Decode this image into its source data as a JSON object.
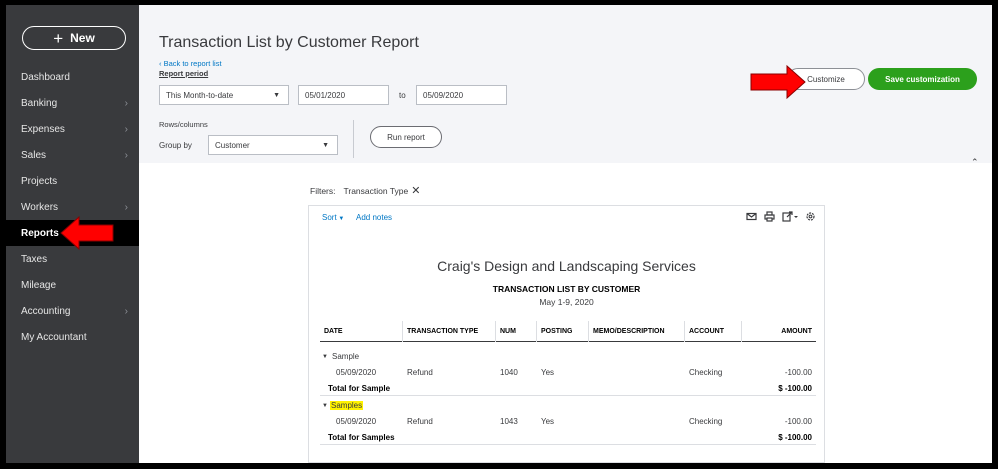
{
  "sidebar": {
    "new_label": "New",
    "items": [
      {
        "label": "Dashboard",
        "has_chevron": false
      },
      {
        "label": "Banking",
        "has_chevron": true
      },
      {
        "label": "Expenses",
        "has_chevron": true
      },
      {
        "label": "Sales",
        "has_chevron": true
      },
      {
        "label": "Projects",
        "has_chevron": false
      },
      {
        "label": "Workers",
        "has_chevron": true
      },
      {
        "label": "Reports",
        "has_chevron": false,
        "active": true
      },
      {
        "label": "Taxes",
        "has_chevron": false
      },
      {
        "label": "Mileage",
        "has_chevron": false
      },
      {
        "label": "Accounting",
        "has_chevron": true
      },
      {
        "label": "My Accountant",
        "has_chevron": false
      }
    ]
  },
  "header": {
    "title": "Transaction List by Customer Report",
    "back_link": "Back to report list",
    "report_period_label": "Report period",
    "period_value": "This Month-to-date",
    "from_date": "05/01/2020",
    "to_label": "to",
    "to_date": "05/09/2020",
    "rows_columns_label": "Rows/columns",
    "group_by_label": "Group by",
    "group_by_value": "Customer",
    "run_report_label": "Run report",
    "customize_label": "Customize",
    "save_customization_label": "Save customization"
  },
  "filters": {
    "label": "Filters:",
    "value": "Transaction Type"
  },
  "report": {
    "sort_label": "Sort",
    "add_notes_label": "Add notes",
    "company": "Craig's Design and Landscaping Services",
    "title": "TRANSACTION LIST BY CUSTOMER",
    "date_range": "May 1-9, 2020",
    "columns": [
      "DATE",
      "TRANSACTION TYPE",
      "NUM",
      "POSTING",
      "MEMO/DESCRIPTION",
      "ACCOUNT",
      "AMOUNT"
    ],
    "groups": [
      {
        "name": "Sample",
        "highlighted": false,
        "rows": [
          {
            "date": "05/09/2020",
            "type": "Refund",
            "num": "1040",
            "posting": "Yes",
            "memo": "",
            "account": "Checking",
            "amount": "-100.00"
          }
        ],
        "total_label": "Total for Sample",
        "total_amount": "$ -100.00"
      },
      {
        "name": "Samples",
        "highlighted": true,
        "rows": [
          {
            "date": "05/09/2020",
            "type": "Refund",
            "num": "1043",
            "posting": "Yes",
            "memo": "",
            "account": "Checking",
            "amount": "-100.00"
          }
        ],
        "total_label": "Total for Samples",
        "total_amount": "$ -100.00"
      }
    ]
  },
  "colors": {
    "sidebar_bg": "#393a3d",
    "accent_green": "#2ca01c",
    "link_blue": "#0077c5",
    "arrow_red": "#ff0000",
    "highlight_yellow": "#fff200"
  }
}
